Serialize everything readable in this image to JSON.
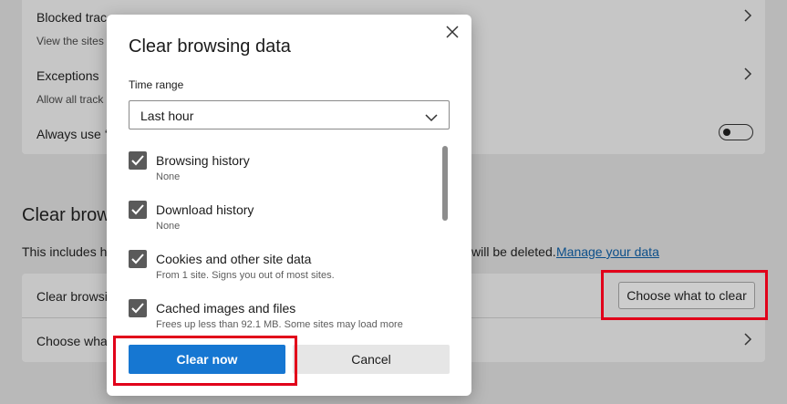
{
  "background": {
    "rows": {
      "blocked_trackers_title": "Blocked trac",
      "blocked_trackers_desc": "View the sites t",
      "exceptions_title": "Exceptions",
      "exceptions_desc": "Allow all track",
      "always_use_title": "Always use ‘",
      "always_use_toggle": "off"
    },
    "clear_section": {
      "title": "Clear brow",
      "includes_text": "This includes hi",
      "deleted_text": "will be deleted.",
      "manage_link": "Manage your data",
      "row1_label": "Clear browsi",
      "choose_button": "Choose what to clear",
      "row2_label": "Choose wha"
    }
  },
  "dialog": {
    "title": "Clear browsing data",
    "time_range_label": "Time range",
    "time_range_value": "Last hour",
    "options": [
      {
        "label": "Browsing history",
        "sub": "None",
        "checked": true
      },
      {
        "label": "Download history",
        "sub": "None",
        "checked": true
      },
      {
        "label": "Cookies and other site data",
        "sub": "From 1 site. Signs you out of most sites.",
        "checked": true
      },
      {
        "label": "Cached images and files",
        "sub": "Frees up less than 92.1 MB. Some sites may load more",
        "checked": true
      }
    ],
    "clear_button": "Clear now",
    "cancel_button": "Cancel"
  },
  "colors": {
    "accent": "#1677d2",
    "highlight": "#e1001a",
    "checkbox": "#5a5a5a",
    "overlay": "#b9b9b9"
  },
  "icons": [
    "chevron-right-icon",
    "close-icon",
    "chevron-down-icon",
    "checkmark-icon"
  ]
}
